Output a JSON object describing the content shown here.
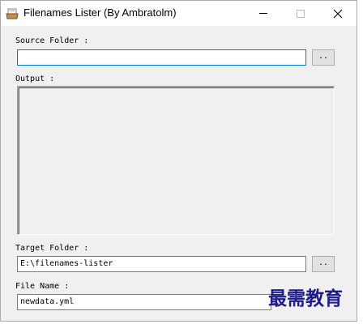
{
  "window": {
    "title": "Filenames Lister (By Ambratolm)"
  },
  "source": {
    "label": "Source Folder :",
    "value": "",
    "browse_label": ".."
  },
  "output": {
    "label": "Output :"
  },
  "target": {
    "label": "Target Folder :",
    "value": "E:\\filenames-lister",
    "browse_label": ".."
  },
  "file_name": {
    "label": "File Name :",
    "value": "newdata.yml"
  },
  "watermark": {
    "text": "最需教育"
  },
  "colors": {
    "focus_border": "#0078d7",
    "window_bg": "#f0f0f0",
    "watermark": "#1c1c8c"
  }
}
